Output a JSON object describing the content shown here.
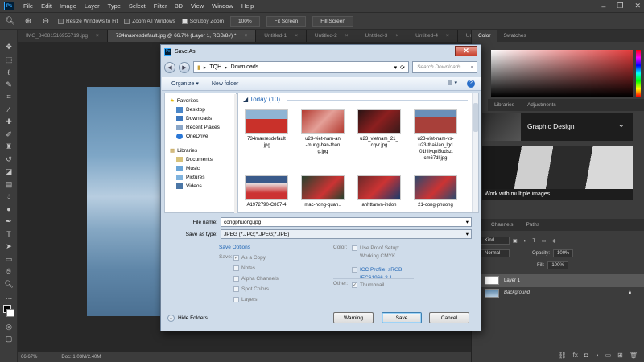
{
  "app": {
    "name": "Photoshop"
  },
  "menubar": {
    "logo": "Ps",
    "items": [
      "File",
      "Edit",
      "Image",
      "Layer",
      "Type",
      "Select",
      "Filter",
      "3D",
      "View",
      "Window",
      "Help"
    ]
  },
  "options": {
    "resize": "Resize Windows to Fit",
    "zoom_all": "Zoom All Windows",
    "scrubby": "Scrubby Zoom",
    "zoom_value": "100%",
    "fit_screen": "Fit Screen",
    "fill_screen": "Fill Screen"
  },
  "doc_tabs": [
    {
      "label": "IMG_840815169557​19.jpg",
      "active": false
    },
    {
      "label": "734maxresdefault.jpg @ 66.7% (Layer 1, RGB/8#) *",
      "active": true
    },
    {
      "label": "Untitled-1",
      "active": false
    },
    {
      "label": "Untitled-2",
      "active": false
    },
    {
      "label": "Untitled-3",
      "active": false
    },
    {
      "label": "Untitled-4",
      "active": false
    },
    {
      "label": "Untitle",
      "active": false
    }
  ],
  "status": {
    "zoom": "66.67%",
    "doc": "Doc: 1.03M/2.40M"
  },
  "right_panel": {
    "tabs_top": [
      "Color",
      "Swatches"
    ],
    "tabs_mid": [
      "Libraries",
      "Adjustments"
    ],
    "learn1": "Graphic Design",
    "learn2": "Work with multiple images",
    "tabs_layers": [
      "Channels",
      "Paths"
    ],
    "kind": "Kind",
    "blend": "Normal",
    "opacity_label": "Opacity:",
    "opacity_value": "100%",
    "fill_label": "Fill:",
    "fill_value": "100%",
    "layers": [
      {
        "name": "Layer 1",
        "selected": true
      },
      {
        "name": "Background",
        "selected": false
      }
    ]
  },
  "dialog": {
    "title": "Save As",
    "path": [
      "TQH",
      "Downloads"
    ],
    "search_placeholder": "Search Downloads",
    "organize": "Organize",
    "new_folder": "New folder",
    "nav": {
      "favorites": "Favorites",
      "fav_items": [
        "Desktop",
        "Downloads",
        "Recent Places",
        "OneDrive"
      ],
      "libraries": "Libraries",
      "lib_items": [
        "Documents",
        "Music",
        "Pictures",
        "Videos"
      ]
    },
    "group_header": "Today (10)",
    "files": [
      {
        "name": "734maxresdefault\n.jpg",
        "color": "#c9312a"
      },
      {
        "name": "u23-viet-nam-an\n-mung-ban-than\ng.jpg",
        "color": "#b33a30"
      },
      {
        "name": "u23_vietnam_21_\ncqvr.jpg",
        "color": "#8c1f1f"
      },
      {
        "name": "u23-viet-nam-vs-\nu23-thai-lan_lgd\nf01hllyqnl5udszt\ncm67dl.jpg",
        "color": "#a8403a"
      },
      {
        "name": "A1972790-C867-4",
        "color": "#3a5a8a"
      },
      {
        "name": "mac-hong-quan..",
        "color": "#26422e"
      },
      {
        "name": "anhttanvn-indon",
        "color": "#6b2a2a"
      },
      {
        "name": "21-cong-phuong",
        "color": "#2c4a6e"
      }
    ],
    "file_name_label": "File name:",
    "file_name_value": "congphuong.jpg",
    "save_type_label": "Save as type:",
    "save_type_value": "JPEG (*.JPG;*.JPEG;*.JPE)",
    "save_options": "Save Options",
    "save_label": "Save:",
    "as_copy": "As a Copy",
    "notes": "Notes",
    "alpha": "Alpha Channels",
    "spot": "Spot Colors",
    "layers": "Layers",
    "color_label": "Color:",
    "proof_setup": "Use Proof Setup:",
    "proof_value": "Working CMYK",
    "icc": "ICC Profile: sRGB",
    "icc_value": "IEC61966-2.1",
    "other_label": "Other:",
    "thumbnail": "Thumbnail",
    "hide_folders": "Hide Folders",
    "warning_btn": "Warning",
    "save_btn": "Save",
    "cancel_btn": "Cancel"
  }
}
